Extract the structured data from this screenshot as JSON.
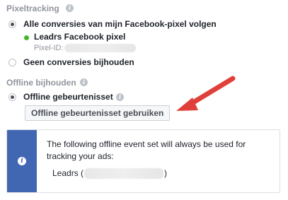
{
  "pixeltracking": {
    "title": "Pixeltracking",
    "option_follow": "Alle conversies van mijn Facebook-pixel volgen",
    "pixel_name": "Leadrs Facebook pixel",
    "pixel_id_label": "Pixel-ID:",
    "option_none": "Geen conversies bijhouden"
  },
  "offline": {
    "title": "Offline bijhouden",
    "option_event_set": "Offline gebeurtenisset",
    "use_button": "Offline gebeurtenisset gebruiken"
  },
  "info_box": {
    "line1": "The following offline event set will always be used for",
    "line2": "tracking your ads:",
    "event_set_prefix": "Leadrs (",
    "event_set_suffix": ")"
  },
  "colors": {
    "accent": "#4267b2",
    "status_active": "#42b72a",
    "arrow": "#e0403a"
  },
  "icons": {
    "info": "info-icon",
    "arrow": "red-arrow-annotation"
  }
}
